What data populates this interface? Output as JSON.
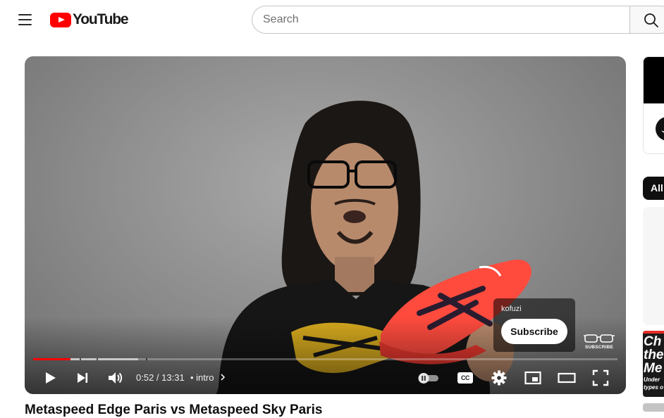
{
  "header": {
    "logo_text": "YouTube",
    "search_placeholder": "Search"
  },
  "player": {
    "current_time": "0:52",
    "duration": "13:31",
    "time_display": "0:52 / 13:31",
    "chapter_label": "• intro",
    "progress_played_fraction": 0.064,
    "progress_buffered_fraction": 0.18,
    "channel_name": "kofuzi",
    "subscribe_label": "Subscribe",
    "watermark_label": "SUBSCRIBE",
    "cc_label": "CC"
  },
  "video": {
    "title": "Metaspeed Edge Paris vs Metaspeed Sky Paris"
  },
  "right_panel": {
    "chip_all_label": "All",
    "thumb_text_lines": [
      "Ch",
      "the",
      "Me"
    ],
    "thumb_sub_lines": [
      "Under",
      "types o"
    ]
  },
  "colors": {
    "brand_red": "#ff0000",
    "progress_red": "#ff0000"
  },
  "icons": [
    "menu-icon",
    "youtube-logo-icon",
    "search-icon",
    "play-icon",
    "next-icon",
    "volume-icon",
    "chevron-right-icon",
    "autoplay-toggle-icon",
    "cc-icon",
    "settings-icon",
    "miniplayer-icon",
    "theater-icon",
    "fullscreen-icon",
    "glasses-icon"
  ]
}
